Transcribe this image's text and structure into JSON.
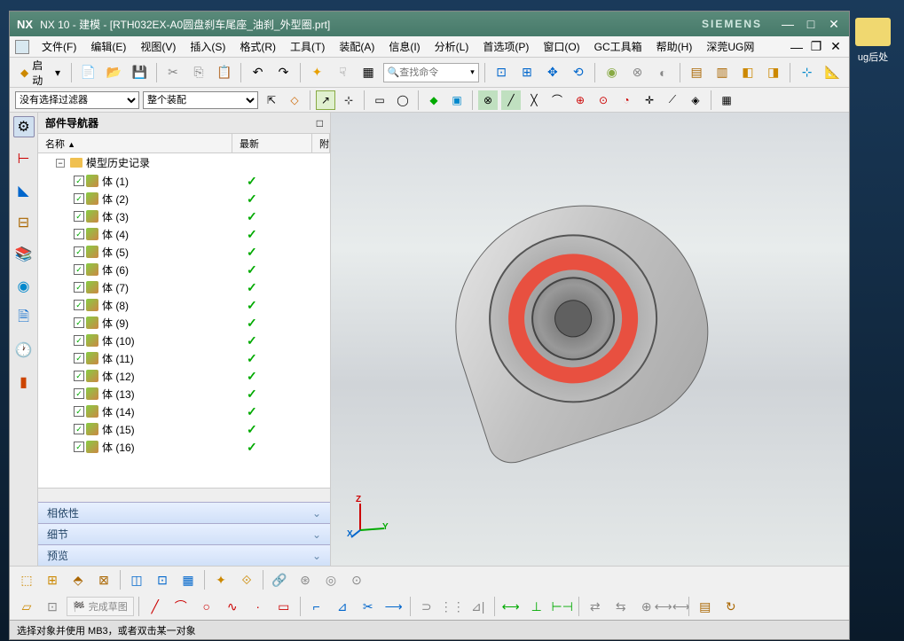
{
  "desktop": {
    "folder_label": "ug后处"
  },
  "titlebar": {
    "nx": "NX",
    "title": "NX 10 - 建模 - [RTH032EX-A0圆盘刹车尾座_油刹_外型圈.prt]",
    "siemens": "SIEMENS"
  },
  "menu": {
    "items": [
      "文件(F)",
      "编辑(E)",
      "视图(V)",
      "插入(S)",
      "格式(R)",
      "工具(T)",
      "装配(A)",
      "信息(I)",
      "分析(L)",
      "首选项(P)",
      "窗口(O)",
      "GC工具箱",
      "帮助(H)",
      "深莞UG网"
    ]
  },
  "toolbar": {
    "launch": "启动",
    "search_placeholder": "查找命令"
  },
  "selection": {
    "filter": "没有选择过滤器",
    "assembly": "整个装配"
  },
  "navigator": {
    "title": "部件导航器",
    "col_name": "名称",
    "col_latest": "最新",
    "col_p": "附",
    "root": "模型历史记录",
    "bodies": [
      {
        "label": "体 (1)"
      },
      {
        "label": "体 (2)"
      },
      {
        "label": "体 (3)"
      },
      {
        "label": "体 (4)"
      },
      {
        "label": "体 (5)"
      },
      {
        "label": "体 (6)"
      },
      {
        "label": "体 (7)"
      },
      {
        "label": "体 (8)"
      },
      {
        "label": "体 (9)"
      },
      {
        "label": "体 (10)"
      },
      {
        "label": "体 (11)"
      },
      {
        "label": "体 (12)"
      },
      {
        "label": "体 (13)"
      },
      {
        "label": "体 (14)"
      },
      {
        "label": "体 (15)"
      },
      {
        "label": "体 (16)"
      }
    ],
    "sections": {
      "dependency": "相依性",
      "details": "细节",
      "preview": "预览"
    }
  },
  "bottom_toolbar": {
    "sketch_label": "完成草图"
  },
  "status": {
    "text": "选择对象并使用 MB3，或者双击某一对象"
  },
  "triad": {
    "x": "X",
    "y": "Y",
    "z": "Z"
  }
}
